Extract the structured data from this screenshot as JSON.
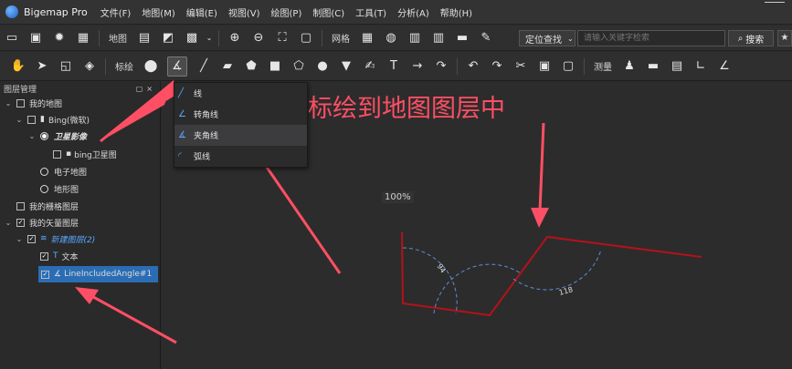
{
  "app": {
    "title": "Bigemap Pro"
  },
  "menu": [
    "文件(F)",
    "地图(M)",
    "编辑(E)",
    "视图(V)",
    "绘图(P)",
    "制图(C)",
    "工具(T)",
    "分析(A)",
    "帮助(H)"
  ],
  "toolbar1": {
    "map_label": "地图",
    "grid_label": "网格",
    "search_mode": "定位查找",
    "search_placeholder": "请输入关键字检索",
    "search_button": "搜索"
  },
  "toolbar2": {
    "annotate_label": "标绘",
    "measure_label": "测量"
  },
  "panel": {
    "title": "图层管理",
    "items": [
      {
        "label": "我的地图"
      },
      {
        "label": "Bing(微软)"
      },
      {
        "label": "卫星影像"
      },
      {
        "label": "bing卫星图"
      },
      {
        "label": "电子地图"
      },
      {
        "label": "地形图"
      },
      {
        "label": "我的栅格图层"
      },
      {
        "label": "我的矢量图层"
      },
      {
        "label": "新建图层(2)"
      },
      {
        "label": "文本"
      },
      {
        "label": "LineIncludedAngle#1"
      }
    ]
  },
  "dropdown": {
    "items": [
      {
        "label": "线",
        "icon": "line-icon"
      },
      {
        "label": "转角线",
        "icon": "turn-angle-line-icon"
      },
      {
        "label": "夹角线",
        "icon": "included-angle-line-icon"
      },
      {
        "label": "弧线",
        "icon": "arc-icon"
      }
    ]
  },
  "map": {
    "annotation": "标绘到地图图层中",
    "zoom_label": "100%",
    "angle_left": "94",
    "angle_right": "118",
    "line_color": "#b3121c",
    "arc_color": "#5b8fd6",
    "arrow_color": "#ff4f64"
  }
}
